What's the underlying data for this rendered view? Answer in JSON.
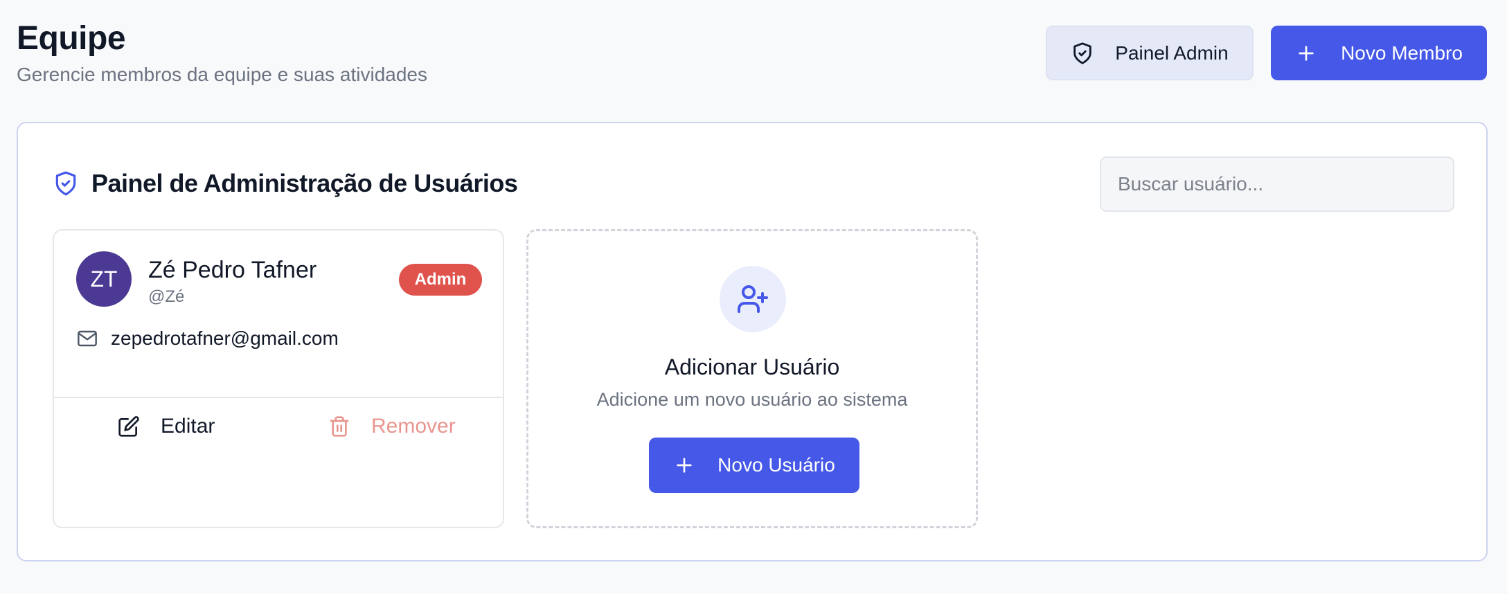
{
  "header": {
    "title": "Equipe",
    "subtitle": "Gerencie membros da equipe e suas atividades",
    "admin_button_label": "Painel Admin",
    "new_member_button_label": "Novo Membro"
  },
  "panel": {
    "heading": "Painel de Administração de Usuários",
    "search_placeholder": "Buscar usuário..."
  },
  "users": [
    {
      "initials": "ZT",
      "name": "Zé Pedro Tafner",
      "handle": "@Zé",
      "role_badge": "Admin",
      "email": "zepedrotafner@gmail.com",
      "edit_label": "Editar",
      "remove_label": "Remover"
    }
  ],
  "add_user_card": {
    "title": "Adicionar Usuário",
    "description": "Adicione um novo usuário ao sistema",
    "button_label": "Novo Usuário"
  },
  "colors": {
    "primary": "#4558e8",
    "admin_badge": "#e0534d",
    "avatar": "#4c3994",
    "remove_text": "#e9958f"
  },
  "icons": {
    "admin_button": "shield-check-icon",
    "new_member_button": "plus-icon",
    "panel_heading": "shield-check-icon",
    "email": "mail-icon",
    "edit": "edit-icon",
    "remove": "trash-icon",
    "add_user": "user-plus-icon",
    "new_user_button": "plus-icon"
  }
}
